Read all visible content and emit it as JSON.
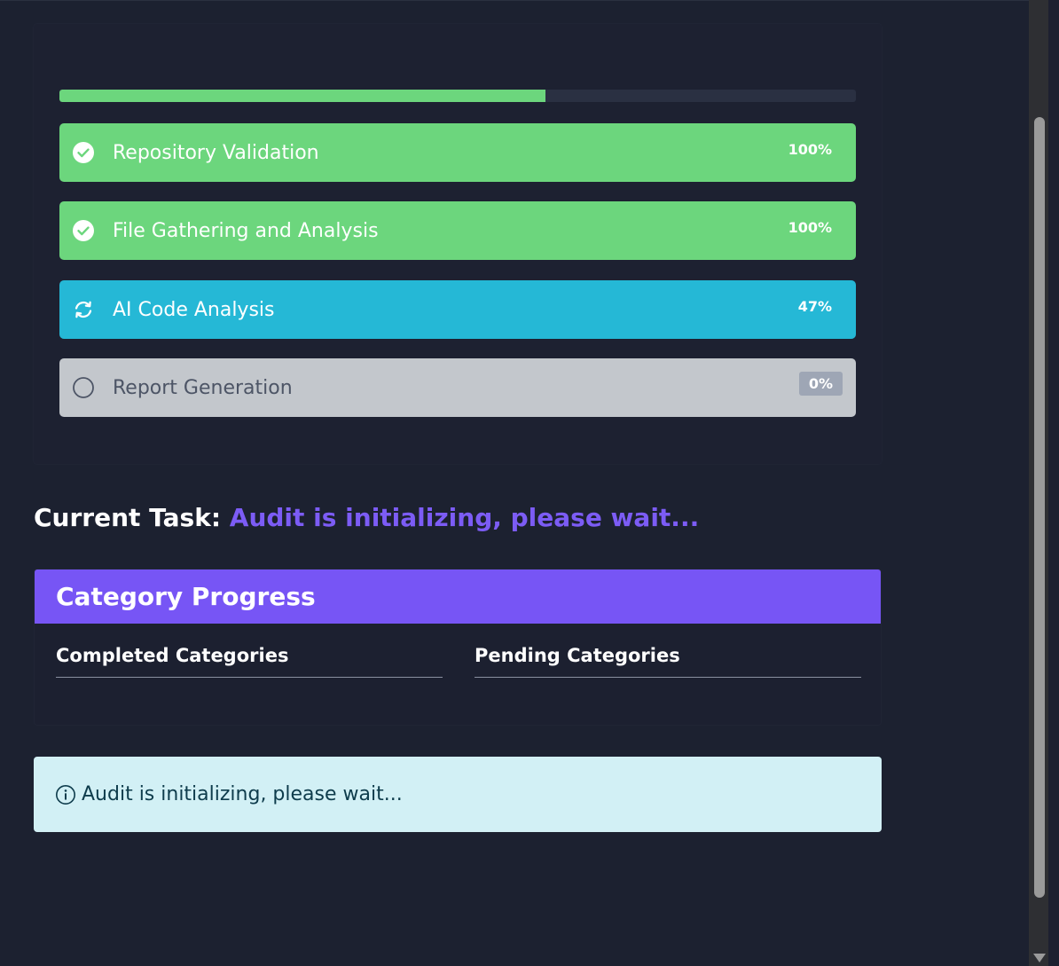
{
  "progress": {
    "overall_fraction": 0.61,
    "steps": [
      {
        "label": "Repository Validation",
        "percent": "100%",
        "status": "done"
      },
      {
        "label": "File Gathering and Analysis",
        "percent": "100%",
        "status": "done"
      },
      {
        "label": "AI Code Analysis",
        "percent": "47%",
        "status": "active"
      },
      {
        "label": "Report Generation",
        "percent": "0%",
        "status": "pending"
      }
    ]
  },
  "current_task": {
    "label": "Current Task:",
    "value": "Audit is initializing, please wait..."
  },
  "category_progress": {
    "title": "Category Progress",
    "completed_label": "Completed Categories",
    "pending_label": "Pending Categories"
  },
  "alert": {
    "text": "Audit is initializing, please wait..."
  },
  "colors": {
    "done": "#6cd67d",
    "active": "#25b8d6",
    "pending": "#c3c7cc",
    "accent": "#7755f5"
  }
}
